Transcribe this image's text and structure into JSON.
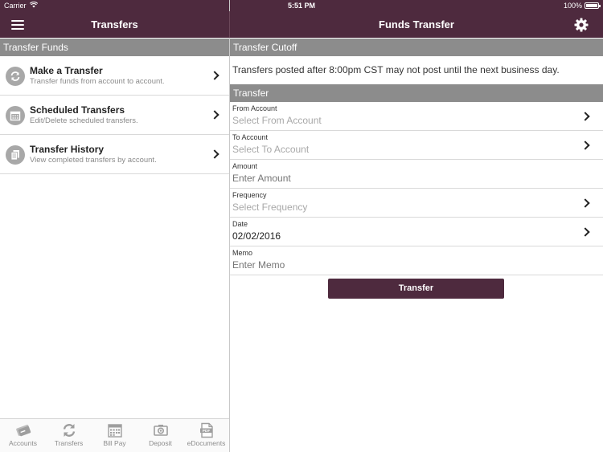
{
  "status_bar": {
    "carrier": "Carrier",
    "time": "5:51 PM",
    "battery": "100%"
  },
  "left_pane": {
    "title": "Transfers",
    "section_header": "Transfer Funds",
    "items": [
      {
        "title": "Make a Transfer",
        "subtitle": "Transfer funds from account to account.",
        "icon": "refresh-icon"
      },
      {
        "title": "Scheduled Transfers",
        "subtitle": "Edit/Delete scheduled transfers.",
        "icon": "calendar-icon"
      },
      {
        "title": "Transfer History",
        "subtitle": "View completed transfers by account.",
        "icon": "documents-icon"
      }
    ]
  },
  "right_pane": {
    "title": "Funds Transfer",
    "cutoff_header": "Transfer Cutoff",
    "cutoff_text": "Transfers posted after 8:00pm CST may not post until the next business day.",
    "transfer_header": "Transfer",
    "fields": [
      {
        "label": "From Account",
        "placeholder": "Select From Account",
        "value": "",
        "chevron": true
      },
      {
        "label": "To Account",
        "placeholder": "Select To Account",
        "value": "",
        "chevron": true
      },
      {
        "label": "Amount",
        "placeholder": "Enter Amount",
        "value": "",
        "chevron": false
      },
      {
        "label": "Frequency",
        "placeholder": "Select Frequency",
        "value": "",
        "chevron": true
      },
      {
        "label": "Date",
        "placeholder": "",
        "value": "02/02/2016",
        "chevron": true
      },
      {
        "label": "Memo",
        "placeholder": "Enter Memo",
        "value": "",
        "chevron": false
      }
    ],
    "submit_label": "Transfer"
  },
  "tab_bar": [
    {
      "label": "Accounts",
      "icon": "accounts-icon"
    },
    {
      "label": "Transfers",
      "icon": "transfers-icon"
    },
    {
      "label": "Bill Pay",
      "icon": "bill-pay-icon"
    },
    {
      "label": "Deposit",
      "icon": "camera-icon"
    },
    {
      "label": "eDocuments",
      "icon": "pdf-icon"
    }
  ],
  "colors": {
    "brand": "#4e2a3e",
    "section_header": "#8c8c8c",
    "icon_gray": "#a8a8a8"
  }
}
